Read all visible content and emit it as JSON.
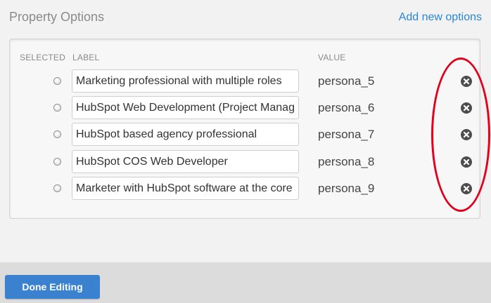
{
  "header": {
    "title": "Property Options",
    "add_link": "Add new options"
  },
  "table": {
    "columns": {
      "selected": "SELECTED",
      "label": "LABEL",
      "value": "VALUE"
    },
    "rows": [
      {
        "label": "Marketing professional with multiple roles",
        "value": "persona_5",
        "selected": false
      },
      {
        "label": "HubSpot Web Development (Project Manage",
        "value": "persona_6",
        "selected": false
      },
      {
        "label": "HubSpot based agency professional",
        "value": "persona_7",
        "selected": false
      },
      {
        "label": "HubSpot COS Web Developer",
        "value": "persona_8",
        "selected": false
      },
      {
        "label": "Marketer with HubSpot software at the core",
        "value": "persona_9",
        "selected": false
      }
    ]
  },
  "icons": {
    "remove": "close-circle-icon"
  },
  "annotation": {
    "color": "#e3001b"
  },
  "footer": {
    "done_label": "Done Editing"
  },
  "colors": {
    "accent": "#2a86d6",
    "button": "#3a82cf"
  }
}
